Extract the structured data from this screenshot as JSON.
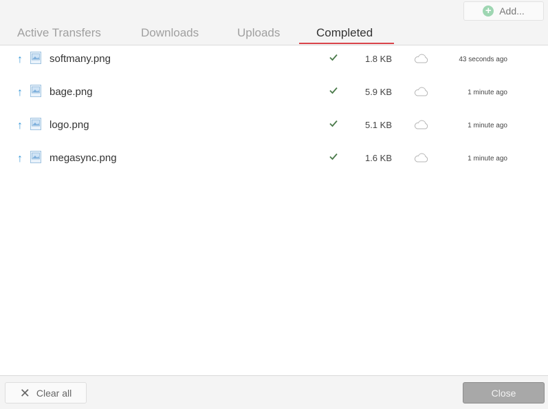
{
  "header": {
    "add_label": "Add...",
    "tabs": [
      {
        "label": "Active Transfers",
        "active": false
      },
      {
        "label": "Downloads",
        "active": false
      },
      {
        "label": "Uploads",
        "active": false
      },
      {
        "label": "Completed",
        "active": true
      }
    ]
  },
  "transfers": [
    {
      "direction": "upload",
      "icon": "image-file-icon",
      "name": "softmany.png",
      "status": "completed",
      "size": "1.8 KB",
      "time": "43 seconds ago"
    },
    {
      "direction": "upload",
      "icon": "image-file-icon",
      "name": "bage.png",
      "status": "completed",
      "size": "5.9 KB",
      "time": "1 minute ago"
    },
    {
      "direction": "upload",
      "icon": "image-file-icon",
      "name": "logo.png",
      "status": "completed",
      "size": "5.1 KB",
      "time": "1 minute ago"
    },
    {
      "direction": "upload",
      "icon": "image-file-icon",
      "name": "megasync.png",
      "status": "completed",
      "size": "1.6 KB",
      "time": "1 minute ago"
    }
  ],
  "footer": {
    "clear_label": "Clear all",
    "close_label": "Close"
  },
  "colors": {
    "active_tab_underline": "#d9434a",
    "upload_arrow": "#3a9ad9",
    "check": "#4a7a4a",
    "add_icon": "#9ed6b2"
  }
}
